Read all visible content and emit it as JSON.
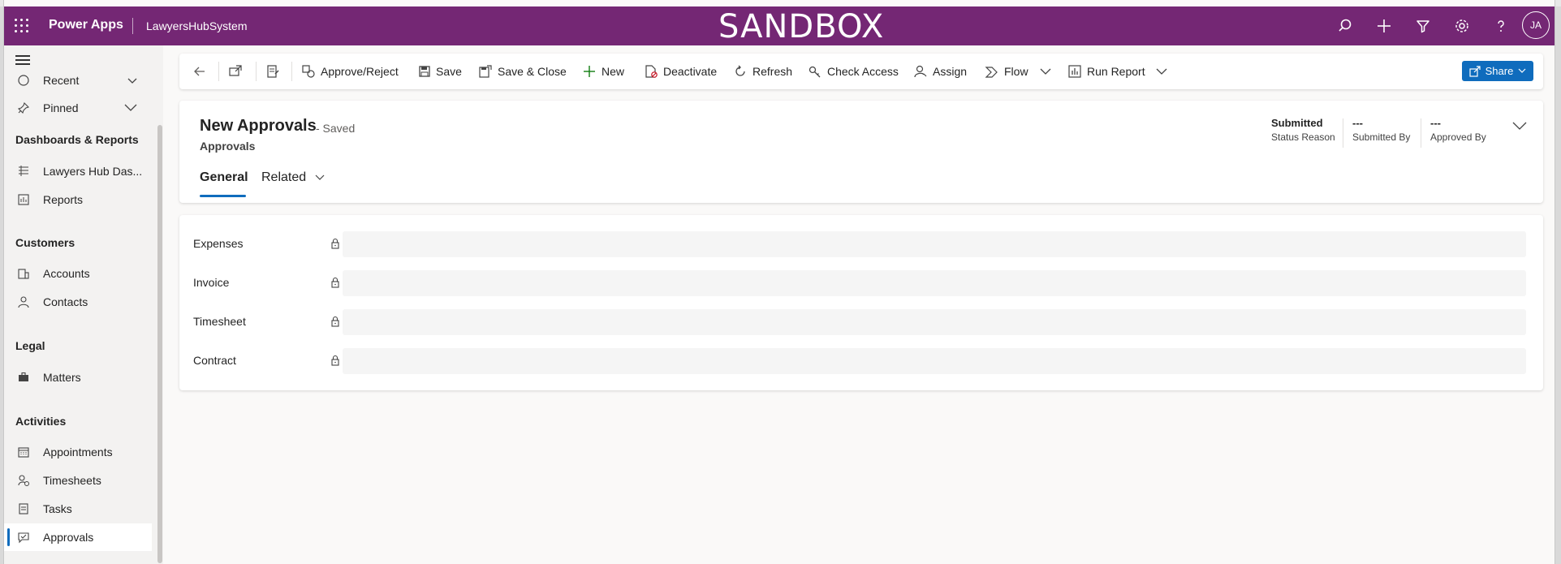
{
  "header": {
    "app_name": "Power Apps",
    "environment": "LawyersHubSystem",
    "banner": "SANDBOX",
    "avatar_initials": "JA",
    "accent_color": "#742774"
  },
  "sidebar": {
    "top_items": [
      {
        "label": "Recent"
      },
      {
        "label": "Pinned"
      }
    ],
    "groups": [
      {
        "title": "Dashboards & Reports",
        "items": [
          {
            "label": "Lawyers Hub Das..."
          },
          {
            "label": "Reports"
          }
        ]
      },
      {
        "title": "Customers",
        "items": [
          {
            "label": "Accounts"
          },
          {
            "label": "Contacts"
          }
        ]
      },
      {
        "title": "Legal",
        "items": [
          {
            "label": "Matters"
          }
        ]
      },
      {
        "title": "Activities",
        "items": [
          {
            "label": "Appointments"
          },
          {
            "label": "Timesheets"
          },
          {
            "label": "Tasks"
          },
          {
            "label": "Approvals"
          }
        ]
      }
    ],
    "active_item": "Approvals"
  },
  "commands": {
    "approve_reject": "Approve/Reject",
    "save": "Save",
    "save_close": "Save & Close",
    "new": "New",
    "deactivate": "Deactivate",
    "refresh": "Refresh",
    "check_access": "Check Access",
    "assign": "Assign",
    "flow": "Flow",
    "run_report": "Run Report",
    "share": "Share"
  },
  "record": {
    "title": "New Approvals",
    "saved_state": "- Saved",
    "entity": "Approvals",
    "tabs": [
      {
        "label": "General"
      },
      {
        "label": "Related"
      }
    ],
    "header_fields": [
      {
        "value": "Submitted",
        "label": "Status Reason"
      },
      {
        "value": "---",
        "label": "Submitted By"
      },
      {
        "value": "---",
        "label": "Approved By"
      }
    ]
  },
  "form": {
    "fields": [
      {
        "label": "Expenses",
        "value": ""
      },
      {
        "label": "Invoice",
        "value": ""
      },
      {
        "label": "Timesheet",
        "value": ""
      },
      {
        "label": "Contract",
        "value": ""
      }
    ]
  }
}
